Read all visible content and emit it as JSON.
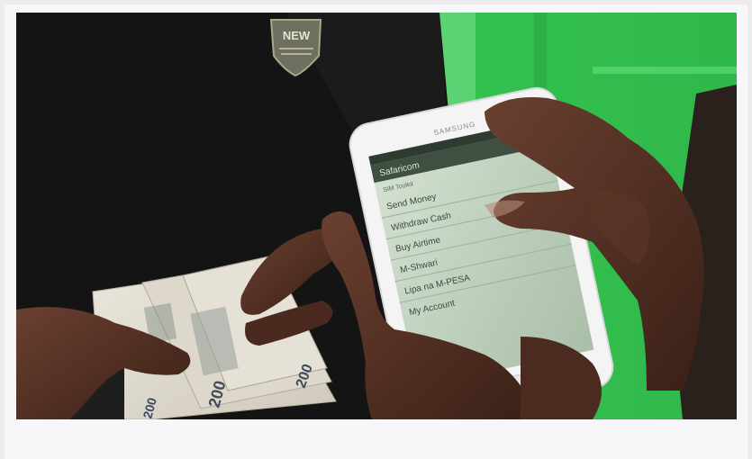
{
  "phone": {
    "brand": "SAMSUNG",
    "app_title": "Safaricom",
    "section": "SIM Toolkit",
    "menu": [
      "Send Money",
      "Withdraw Cash",
      "Buy Airtime",
      "M-Shwari",
      "Lipa na M-PESA",
      "My Account"
    ]
  },
  "shirt_badge": "NEW",
  "banknote_value": "200",
  "colors": {
    "background_green": "#3dcb58",
    "shirt": "#141414",
    "phone_body": "#f4f4f4",
    "screen": "#c7d6c5"
  }
}
